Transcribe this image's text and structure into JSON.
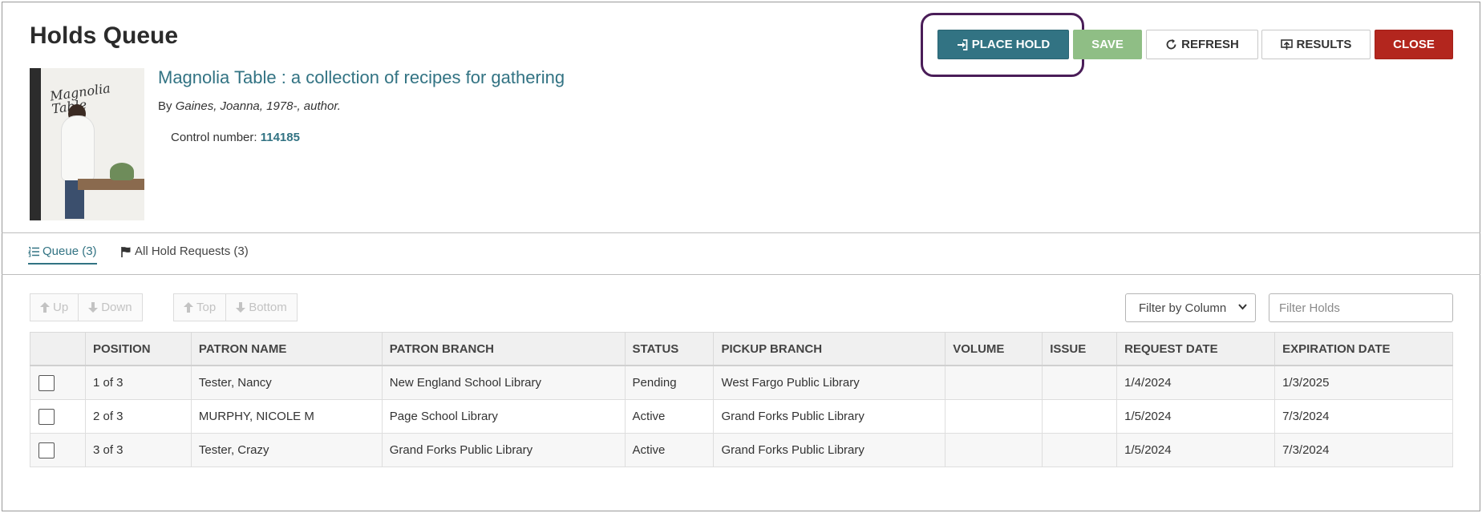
{
  "page": {
    "title": "Holds Queue"
  },
  "toolbar": {
    "place_hold": "PLACE HOLD",
    "save": "SAVE",
    "refresh": "REFRESH",
    "results": "RESULTS",
    "close": "CLOSE"
  },
  "record": {
    "title": "Magnolia Table : a collection of recipes for gathering",
    "by_label": "By",
    "author": "Gaines, Joanna, 1978-, author.",
    "control_label": "Control number:",
    "control_number": "114185",
    "cover": {
      "title": "Magnolia Table"
    }
  },
  "tabs": {
    "queue": "Queue (3)",
    "all_holds": "All Hold Requests (3)"
  },
  "move_buttons": {
    "up": "Up",
    "down": "Down",
    "top": "Top",
    "bottom": "Bottom"
  },
  "filter": {
    "select_value": "Filter by Column",
    "input_placeholder": "Filter Holds"
  },
  "table": {
    "columns": [
      "POSITION",
      "PATRON NAME",
      "PATRON BRANCH",
      "STATUS",
      "PICKUP BRANCH",
      "VOLUME",
      "ISSUE",
      "REQUEST DATE",
      "EXPIRATION DATE"
    ],
    "rows": [
      {
        "position": "1 of 3",
        "patron_name": "Tester, Nancy",
        "patron_branch": "New England School Library",
        "status": "Pending",
        "pickup_branch": "West Fargo Public Library",
        "volume": "",
        "issue": "",
        "request_date": "1/4/2024",
        "expiration_date": "1/3/2025"
      },
      {
        "position": "2 of 3",
        "patron_name": "MURPHY, NICOLE M",
        "patron_branch": "Page School Library",
        "status": "Active",
        "pickup_branch": "Grand Forks Public Library",
        "volume": "",
        "issue": "",
        "request_date": "1/5/2024",
        "expiration_date": "7/3/2024"
      },
      {
        "position": "3 of 3",
        "patron_name": "Tester, Crazy",
        "patron_branch": "Grand Forks Public Library",
        "status": "Active",
        "pickup_branch": "Grand Forks Public Library",
        "volume": "",
        "issue": "",
        "request_date": "1/5/2024",
        "expiration_date": "7/3/2024"
      }
    ]
  },
  "colors": {
    "primary": "#327383",
    "save": "#8fbe85",
    "close": "#b3261e",
    "highlight": "#4a1d58"
  }
}
